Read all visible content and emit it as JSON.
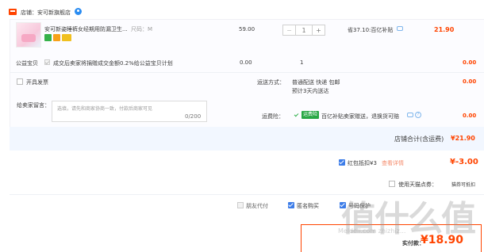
{
  "shop": {
    "name": "店铺：安可新旗舰店"
  },
  "item": {
    "title": "安可新姿睡裤女经期用防漏卫生...",
    "sku": "尺码：M",
    "price": "59.00",
    "quantity": "1",
    "subsidy": "省37.10:百亿补贴",
    "total": "21.90"
  },
  "public_welfare": {
    "label": "公益宝贝",
    "text": "成交后卖家将捐赠成交金额0.2%给公益宝贝计划",
    "price": "0.00",
    "quantity": "1",
    "total": "0.00"
  },
  "invoice": {
    "label": "开具发票"
  },
  "shipping": {
    "label": "运送方式：",
    "option": "普通配送 快递 包邮",
    "eta": "预计3天内送达",
    "fee": "0.00"
  },
  "message": {
    "label": "给卖家留言：",
    "placeholder": "选填，请先和商家协商一致，付款后商家可见",
    "count": "0/200"
  },
  "insurance": {
    "label": "运费险：",
    "tag": "运费险",
    "text": "百亿补贴卖家赠送，退换货可赔",
    "fee": "0.00"
  },
  "shop_total": {
    "label": "店铺合计(含运费)",
    "value": "¥21.90"
  },
  "red_packet": {
    "label": "红包抵扣¥3",
    "link": "查看详情",
    "amount": "¥-3.00"
  },
  "tmall_coupon": {
    "label": "使用天猫点券：",
    "max": "猫券可抵扣"
  },
  "options": {
    "friend_pay": "朋友代付",
    "anonymous": "匿名购买",
    "protect": "号码保护"
  },
  "payment": {
    "label": "实付款：",
    "value": "¥18.90"
  },
  "watermark": {
    "text": "值什么值",
    "sub": "Meldeli.com zhizhiz..."
  },
  "colors": {
    "accent": "#ff4400",
    "check_blue": "#3d7de8",
    "panel_bg": "#fcfcff",
    "sum_bar": "#f2f7ff"
  }
}
